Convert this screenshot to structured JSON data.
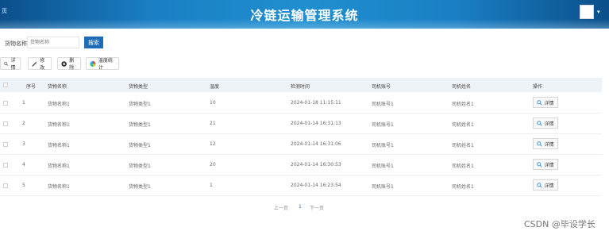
{
  "header": {
    "title": "冷链运输管理系统",
    "logo_text": "页",
    "user_caret": "▾"
  },
  "search": {
    "label": "货物名称",
    "placeholder": "货物名称",
    "button_label": "搜索"
  },
  "toolbar": {
    "detail_label": "详情",
    "edit_label": "修改",
    "delete_label": "删除",
    "stats_label": "温度统计"
  },
  "table": {
    "columns": [
      "序号",
      "货物名称",
      "货物类型",
      "温度",
      "检测时间",
      "司机账号",
      "司机姓名",
      "操作"
    ],
    "rows": [
      {
        "no": "1",
        "name": "货物名称1",
        "type": "货物类型1",
        "temp": "10",
        "time": "2024-01-18 11:15:11",
        "account": "司机账号1",
        "driver": "司机姓名1"
      },
      {
        "no": "2",
        "name": "货物名称1",
        "type": "货物类型1",
        "temp": "21",
        "time": "2024-01-14 16:31:13",
        "account": "司机账号1",
        "driver": "司机姓名1"
      },
      {
        "no": "3",
        "name": "货物名称1",
        "type": "货物类型1",
        "temp": "12",
        "time": "2024-01-14 16:31:06",
        "account": "司机账号1",
        "driver": "司机姓名1"
      },
      {
        "no": "4",
        "name": "货物名称1",
        "type": "货物类型1",
        "temp": "20",
        "time": "2024-01-14 16:30:53",
        "account": "司机账号1",
        "driver": "司机姓名1"
      },
      {
        "no": "5",
        "name": "货物名称1",
        "type": "货物类型1",
        "temp": "1",
        "time": "2024-01-14 16:23:54",
        "account": "司机账号1",
        "driver": "司机姓名1"
      }
    ],
    "row_action_label": "详情"
  },
  "pagination": {
    "prev": "上一页",
    "current": "1",
    "next": "下一页"
  },
  "watermark": "CSDN @毕设学长",
  "colors": {
    "header_dark": "#0b4f8a",
    "header_light": "#1f8fd0",
    "primary": "#1e6bb8",
    "table_header_bg": "#eef3f8"
  },
  "icons": {
    "detail": "search-icon",
    "edit": "pencil-icon",
    "delete": "close-circle-icon",
    "stats": "pie-chart-icon"
  }
}
